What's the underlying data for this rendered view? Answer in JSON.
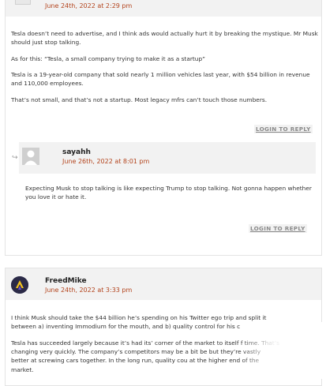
{
  "comment1": {
    "date": "June 24th, 2022 at 2:29 pm",
    "paragraphs": [
      "Tesla doesn’t need to advertise, and I think ads would actually hurt it by breaking the mystique. Mr Musk should just stop talking.",
      "As for this: “Tesla, a small company trying to make it as a startup”",
      "Tesla is a 19-year-old company that sold nearly 1 million vehicles last year, with $54 billion in revenue and 110,000 employees.",
      "That’s not small, and that’s not a startup. Most legacy mfrs can’t touch those numbers."
    ],
    "reply_label": "LOGIN TO REPLY"
  },
  "reply1": {
    "author": "sayahh",
    "date": "June 26th, 2022 at 8:01 pm",
    "paragraphs": [
      "Expecting Musk to stop talking is like expecting Trump to stop talking. Not gonna happen whether you love it or hate it."
    ],
    "reply_label": "LOGIN TO REPLY",
    "reply_icon": "reply-arrow-icon"
  },
  "comment2": {
    "author": "FreedMike",
    "date": "June 24th, 2022 at 3:33 pm",
    "paragraphs": [
      "I think Musk should take the $44 billion he’s spending on his Twitter ego trip and split it between a) inventing Immodium for the mouth, and b) quality control for his c",
      "Tesla has succeeded largely because it’s had its’ corner of the market to itself f time. That’s changing very quickly. The company’s competitors may be a bit be but they’re vastly better at screwing cars together. In the long run, quality cou at the higher end of the market."
    ]
  },
  "colors": {
    "date": "#b3441d",
    "header_bg": "#f2f2f2",
    "button_text": "#8a8a8a"
  }
}
